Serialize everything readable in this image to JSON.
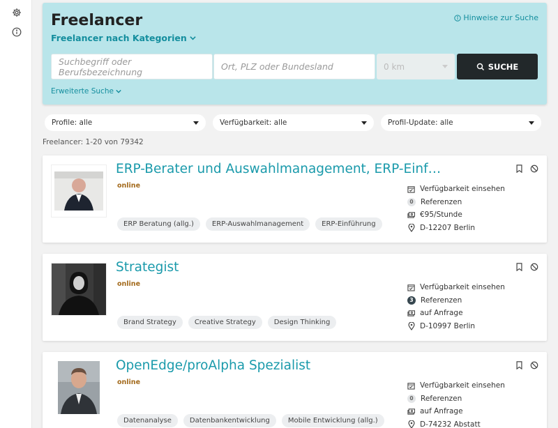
{
  "search": {
    "title": "Freelancer",
    "categories_label": "Freelancer nach Kategorien",
    "hint_label": "Hinweise zur Suche",
    "keyword_placeholder": "Suchbegriff oder Berufsbezeichnung",
    "location_placeholder": "Ort, PLZ oder Bundesland",
    "radius_value": "0 km",
    "submit_label": "SUCHE",
    "advanced_label": "Erweiterte Suche"
  },
  "filters": [
    {
      "label": "Profile: alle"
    },
    {
      "label": "Verfügbarkeit: alle"
    },
    {
      "label": "Profil-Update: alle"
    }
  ],
  "result_count": "Freelancer: 1-20 von 79342",
  "cards": [
    {
      "name": "ERP-Berater und Auswahlmanagement, ERP-Einführu...",
      "status": "online",
      "tags": [
        "ERP Beratung (allg.)",
        "ERP-Auswahlmanagement",
        "ERP-Einführung"
      ],
      "availability": "Verfügbarkeit einsehen",
      "references_count": "0",
      "references_label": "Referenzen",
      "rate": "€95/Stunde",
      "location": "D-12207 Berlin"
    },
    {
      "name": "Strategist",
      "status": "online",
      "tags": [
        "Brand Strategy",
        "Creative Strategy",
        "Design Thinking"
      ],
      "availability": "Verfügbarkeit einsehen",
      "references_count": "3",
      "references_label": "Referenzen",
      "rate": "auf Anfrage",
      "location": "D-10997 Berlin"
    },
    {
      "name": "OpenEdge/proAlpha Spezialist",
      "status": "online",
      "tags": [
        "Datenanalyse",
        "Datenbankentwicklung",
        "Mobile Entwicklung (allg.)"
      ],
      "availability": "Verfügbarkeit einsehen",
      "references_count": "0",
      "references_label": "Referenzen",
      "rate": "auf Anfrage",
      "location": "D-74232 Abstatt"
    }
  ],
  "colors": {
    "accent": "#1a9aab",
    "search_bg": "#b9e5ea",
    "button_dark": "#22282a",
    "online": "#a36a1c"
  },
  "icons": {
    "sidebar": [
      "gear-icon",
      "info-icon"
    ],
    "card_actions": [
      "bookmark-icon",
      "block-icon"
    ],
    "card_meta": [
      "calendar-check-icon",
      "references-badge",
      "money-icon",
      "location-pin-icon"
    ]
  }
}
